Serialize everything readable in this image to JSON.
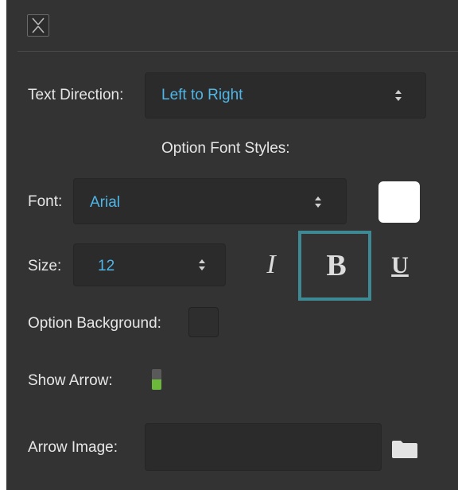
{
  "colors": {
    "panel_bg": "#333333",
    "field_bg": "#2b2b2b",
    "value_text": "#4fb6e8",
    "label_text": "#e6e6e6",
    "highlight_frame": "#3d8a94",
    "toggle_on": "#6bb83a"
  },
  "header": {
    "close_icon": "close-icon"
  },
  "text_direction": {
    "label": "Text Direction:",
    "value": "Left to Right"
  },
  "section_title": "Option Font Styles:",
  "font": {
    "label": "Font:",
    "value": "Arial",
    "color_swatch": "#ffffff"
  },
  "size": {
    "label": "Size:",
    "value": "12"
  },
  "styles": {
    "italic": "I",
    "bold": "B",
    "underline": "U"
  },
  "option_background": {
    "label": "Option Background:"
  },
  "show_arrow": {
    "label": "Show Arrow:",
    "enabled": true
  },
  "arrow_image": {
    "label": "Arrow Image:",
    "value": "",
    "icon": "folder-icon"
  }
}
